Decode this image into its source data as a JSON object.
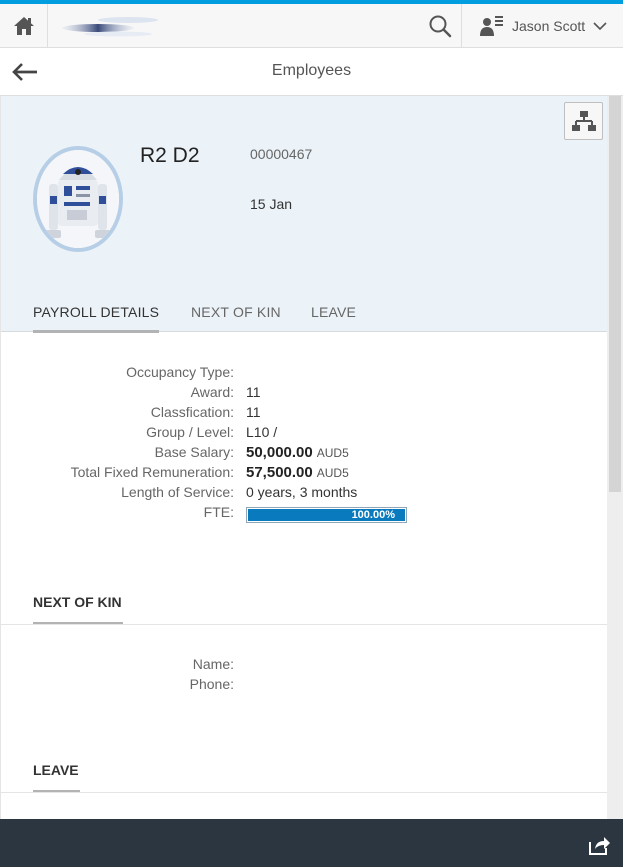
{
  "shell": {
    "user_name": "Jason Scott",
    "accent_color": "#009de0"
  },
  "page": {
    "title": "Employees"
  },
  "employee": {
    "name": "R2 D2",
    "id": "00000467",
    "date": "15 Jan"
  },
  "tabs": [
    {
      "label": "PAYROLL DETAILS",
      "active": true
    },
    {
      "label": "NEXT OF KIN",
      "active": false
    },
    {
      "label": "LEAVE",
      "active": false
    }
  ],
  "payroll": {
    "occupancy_type_label": "Occupancy Type:",
    "occupancy_type_value": "",
    "award_label": "Award:",
    "award_value": "11",
    "classification_label": "Classfication:",
    "classification_value": "11",
    "group_level_label": "Group / Level:",
    "group_level_value": "L10 /",
    "base_salary_label": "Base Salary:",
    "base_salary_amount": "50,000.00",
    "base_salary_unit": "AUD5",
    "total_fixed_label": "Total Fixed Remuneration:",
    "total_fixed_amount": "57,500.00",
    "total_fixed_unit": "AUD5",
    "length_service_label": "Length of Service:",
    "length_service_value": "0 years, 3 months",
    "fte_label": "FTE:",
    "fte_text": "100.00%",
    "fte_fraction": 1.0
  },
  "next_of_kin": {
    "title": "NEXT OF KIN",
    "name_label": "Name:",
    "phone_label": "Phone:"
  },
  "leave": {
    "title": "LEAVE"
  },
  "icons": {
    "home": "home-icon",
    "search": "search-icon",
    "user": "user-icon",
    "back": "back-arrow-icon",
    "org": "org-chart-icon",
    "share": "share-icon"
  }
}
